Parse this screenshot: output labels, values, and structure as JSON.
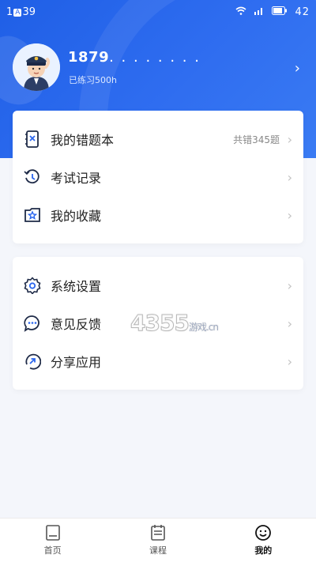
{
  "status_bar": {
    "time_left": "1",
    "time_badge": "A",
    "time_right": "39",
    "right_text": "42"
  },
  "profile": {
    "username": "1879",
    "username_mask": ". . . . . . . .",
    "practice": "已练习500h",
    "avatar": "police-officer-avatar"
  },
  "menu_group_1": [
    {
      "icon": "mistake-book-icon",
      "label": "我的错题本",
      "extra": "共错345题"
    },
    {
      "icon": "exam-history-icon",
      "label": "考试记录",
      "extra": ""
    },
    {
      "icon": "favorites-icon",
      "label": "我的收藏",
      "extra": ""
    }
  ],
  "menu_group_2": [
    {
      "icon": "settings-gear-icon",
      "label": "系统设置"
    },
    {
      "icon": "feedback-chat-icon",
      "label": "意见反馈"
    },
    {
      "icon": "share-icon",
      "label": "分享应用"
    }
  ],
  "watermark": {
    "main": "4355",
    "suffix": "游戏",
    "domain": ".cn"
  },
  "tabbar": [
    {
      "icon": "home-icon",
      "label": "首页",
      "active": false
    },
    {
      "icon": "course-icon",
      "label": "课程",
      "active": false
    },
    {
      "icon": "profile-smile-icon",
      "label": "我的",
      "active": true
    }
  ],
  "colors": {
    "brand_blue": "#2b66ee",
    "background": "#f4f6fb",
    "card": "#ffffff"
  }
}
